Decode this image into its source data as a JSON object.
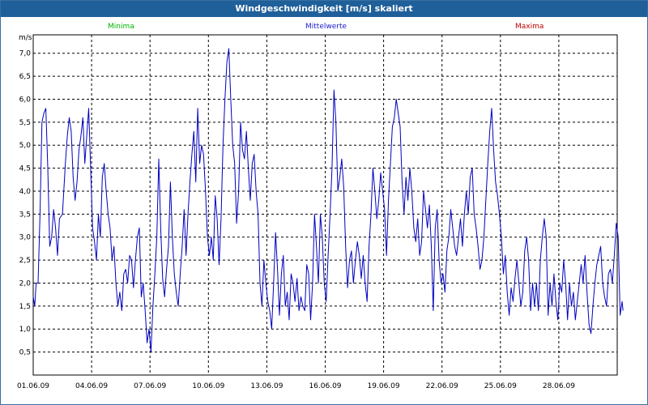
{
  "window": {
    "title": "Windgeschwindigkeit [m/s] skaliert"
  },
  "colors": {
    "series": "#0000c0",
    "minima": "#00b400",
    "mittelwerte": "#1a1ad0",
    "maxima": "#c00000",
    "titlebar": "#1f5f9a"
  },
  "chart_data": {
    "type": "line",
    "title": "Windgeschwindigkeit [m/s] skaliert",
    "ylabel": "m/s",
    "xlabel": "",
    "legend": [
      "Minima",
      "Mittelwerte",
      "Maxima"
    ],
    "legend_placement": "top",
    "grid": true,
    "ylim": [
      0,
      7.4
    ],
    "xlim": [
      "01.06.09",
      "30.06.09 24:00"
    ],
    "y_ticks": [
      "0,5",
      "1,0",
      "1,5",
      "2,0",
      "2,5",
      "3,0",
      "3,5",
      "4,0",
      "4,5",
      "5,0",
      "5,5",
      "6,0",
      "6,5",
      "7,0"
    ],
    "x_ticks": [
      "01.06.09",
      "04.06.09",
      "07.06.09",
      "10.06.09",
      "13.06.09",
      "16.06.09",
      "19.06.09",
      "22.06.09",
      "25.06.09",
      "28.06.09"
    ],
    "series": [
      {
        "name": "Mittelwerte",
        "x_unit": "days from 01.06.09 00:00",
        "points": [
          [
            0.0,
            1.7
          ],
          [
            0.08,
            1.5
          ],
          [
            0.15,
            2.0
          ],
          [
            0.25,
            2.0
          ],
          [
            0.35,
            3.5
          ],
          [
            0.45,
            5.5
          ],
          [
            0.55,
            5.7
          ],
          [
            0.65,
            5.8
          ],
          [
            0.75,
            4.5
          ],
          [
            0.85,
            2.8
          ],
          [
            0.95,
            3.0
          ],
          [
            1.05,
            3.6
          ],
          [
            1.15,
            3.2
          ],
          [
            1.25,
            2.6
          ],
          [
            1.35,
            3.4
          ],
          [
            1.5,
            3.5
          ],
          [
            1.65,
            4.6
          ],
          [
            1.75,
            5.2
          ],
          [
            1.85,
            5.6
          ],
          [
            1.95,
            5.3
          ],
          [
            2.05,
            4.3
          ],
          [
            2.15,
            3.8
          ],
          [
            2.25,
            4.2
          ],
          [
            2.35,
            4.9
          ],
          [
            2.45,
            5.2
          ],
          [
            2.55,
            5.6
          ],
          [
            2.65,
            4.6
          ],
          [
            2.75,
            5.2
          ],
          [
            2.85,
            5.8
          ],
          [
            2.95,
            4.5
          ],
          [
            3.05,
            3.2
          ],
          [
            3.15,
            2.9
          ],
          [
            3.25,
            2.5
          ],
          [
            3.35,
            3.5
          ],
          [
            3.45,
            3.0
          ],
          [
            3.55,
            4.3
          ],
          [
            3.65,
            4.6
          ],
          [
            3.75,
            4.0
          ],
          [
            3.85,
            3.5
          ],
          [
            3.95,
            3.2
          ],
          [
            4.05,
            2.5
          ],
          [
            4.15,
            2.8
          ],
          [
            4.25,
            2.0
          ],
          [
            4.35,
            1.5
          ],
          [
            4.45,
            1.8
          ],
          [
            4.55,
            1.4
          ],
          [
            4.65,
            2.2
          ],
          [
            4.75,
            2.3
          ],
          [
            4.85,
            2.0
          ],
          [
            4.95,
            2.6
          ],
          [
            5.05,
            2.5
          ],
          [
            5.15,
            1.9
          ],
          [
            5.25,
            2.5
          ],
          [
            5.35,
            3.0
          ],
          [
            5.45,
            3.2
          ],
          [
            5.55,
            1.7
          ],
          [
            5.65,
            2.0
          ],
          [
            5.75,
            1.4
          ],
          [
            5.85,
            0.7
          ],
          [
            5.95,
            1.0
          ],
          [
            6.05,
            0.5
          ],
          [
            6.15,
            1.5
          ],
          [
            6.25,
            2.2
          ],
          [
            6.35,
            3.0
          ],
          [
            6.45,
            4.7
          ],
          [
            6.55,
            3.2
          ],
          [
            6.65,
            2.1
          ],
          [
            6.75,
            1.7
          ],
          [
            6.85,
            2.3
          ],
          [
            6.95,
            2.8
          ],
          [
            7.05,
            4.2
          ],
          [
            7.15,
            3.0
          ],
          [
            7.25,
            2.2
          ],
          [
            7.35,
            1.8
          ],
          [
            7.45,
            1.5
          ],
          [
            7.55,
            2.2
          ],
          [
            7.65,
            2.8
          ],
          [
            7.75,
            3.6
          ],
          [
            7.85,
            2.6
          ],
          [
            7.95,
            3.5
          ],
          [
            8.05,
            4.2
          ],
          [
            8.15,
            4.8
          ],
          [
            8.25,
            5.3
          ],
          [
            8.35,
            4.2
          ],
          [
            8.45,
            5.8
          ],
          [
            8.55,
            4.6
          ],
          [
            8.65,
            5.0
          ],
          [
            8.75,
            4.8
          ],
          [
            8.85,
            4.0
          ],
          [
            8.95,
            3.0
          ],
          [
            9.05,
            2.6
          ],
          [
            9.15,
            3.0
          ],
          [
            9.25,
            2.5
          ],
          [
            9.35,
            3.9
          ],
          [
            9.45,
            3.4
          ],
          [
            9.55,
            2.4
          ],
          [
            9.65,
            3.4
          ],
          [
            9.75,
            5.0
          ],
          [
            9.85,
            6.0
          ],
          [
            9.95,
            6.8
          ],
          [
            10.05,
            7.1
          ],
          [
            10.15,
            6.0
          ],
          [
            10.25,
            5.0
          ],
          [
            10.35,
            4.6
          ],
          [
            10.45,
            3.3
          ],
          [
            10.55,
            4.0
          ],
          [
            10.65,
            5.5
          ],
          [
            10.75,
            4.9
          ],
          [
            10.85,
            4.7
          ],
          [
            10.95,
            5.3
          ],
          [
            11.05,
            4.5
          ],
          [
            11.15,
            3.8
          ],
          [
            11.25,
            4.6
          ],
          [
            11.35,
            4.8
          ],
          [
            11.45,
            4.0
          ],
          [
            11.55,
            3.5
          ],
          [
            11.65,
            2.0
          ],
          [
            11.75,
            1.5
          ],
          [
            11.85,
            2.5
          ],
          [
            11.95,
            2.0
          ],
          [
            12.05,
            1.6
          ],
          [
            12.15,
            1.4
          ],
          [
            12.25,
            1.0
          ],
          [
            12.35,
            2.0
          ],
          [
            12.45,
            3.1
          ],
          [
            12.55,
            2.3
          ],
          [
            12.65,
            1.3
          ],
          [
            12.75,
            2.2
          ],
          [
            12.85,
            2.6
          ],
          [
            12.95,
            1.5
          ],
          [
            13.05,
            1.8
          ],
          [
            13.15,
            1.2
          ],
          [
            13.25,
            2.2
          ],
          [
            13.35,
            2.0
          ],
          [
            13.45,
            1.6
          ],
          [
            13.55,
            2.1
          ],
          [
            13.65,
            1.4
          ],
          [
            13.75,
            1.7
          ],
          [
            13.85,
            1.5
          ],
          [
            13.95,
            1.4
          ],
          [
            14.05,
            2.4
          ],
          [
            14.15,
            2.2
          ],
          [
            14.25,
            1.2
          ],
          [
            14.35,
            2.0
          ],
          [
            14.45,
            3.5
          ],
          [
            14.55,
            2.8
          ],
          [
            14.65,
            2.0
          ],
          [
            14.75,
            3.5
          ],
          [
            14.85,
            3.0
          ],
          [
            14.95,
            2.0
          ],
          [
            15.05,
            1.6
          ],
          [
            15.15,
            2.6
          ],
          [
            15.25,
            3.5
          ],
          [
            15.35,
            4.5
          ],
          [
            15.45,
            6.2
          ],
          [
            15.55,
            5.5
          ],
          [
            15.65,
            4.0
          ],
          [
            15.75,
            4.3
          ],
          [
            15.85,
            4.7
          ],
          [
            15.95,
            4.1
          ],
          [
            16.05,
            2.8
          ],
          [
            16.15,
            1.9
          ],
          [
            16.25,
            2.5
          ],
          [
            16.35,
            2.7
          ],
          [
            16.45,
            2.0
          ],
          [
            16.55,
            2.5
          ],
          [
            16.65,
            2.9
          ],
          [
            16.75,
            2.6
          ],
          [
            16.85,
            2.1
          ],
          [
            16.95,
            2.6
          ],
          [
            17.05,
            2.0
          ],
          [
            17.15,
            1.6
          ],
          [
            17.25,
            2.8
          ],
          [
            17.35,
            3.5
          ],
          [
            17.45,
            4.5
          ],
          [
            17.55,
            4.0
          ],
          [
            17.65,
            3.4
          ],
          [
            17.75,
            3.8
          ],
          [
            17.85,
            4.4
          ],
          [
            17.95,
            4.0
          ],
          [
            18.05,
            3.6
          ],
          [
            18.15,
            2.6
          ],
          [
            18.25,
            3.8
          ],
          [
            18.35,
            4.6
          ],
          [
            18.45,
            5.4
          ],
          [
            18.55,
            5.6
          ],
          [
            18.65,
            6.0
          ],
          [
            18.75,
            5.7
          ],
          [
            18.85,
            5.4
          ],
          [
            18.95,
            4.2
          ],
          [
            19.05,
            3.5
          ],
          [
            19.15,
            4.3
          ],
          [
            19.25,
            3.8
          ],
          [
            19.35,
            4.5
          ],
          [
            19.45,
            4.0
          ],
          [
            19.55,
            3.2
          ],
          [
            19.65,
            2.9
          ],
          [
            19.75,
            3.4
          ],
          [
            19.85,
            2.6
          ],
          [
            19.95,
            2.9
          ],
          [
            20.05,
            4.0
          ],
          [
            20.15,
            3.6
          ],
          [
            20.25,
            3.2
          ],
          [
            20.35,
            3.7
          ],
          [
            20.45,
            2.8
          ],
          [
            20.55,
            1.4
          ],
          [
            20.65,
            3.2
          ],
          [
            20.75,
            3.6
          ],
          [
            20.85,
            2.5
          ],
          [
            20.95,
            2.0
          ],
          [
            21.05,
            2.2
          ],
          [
            21.15,
            1.8
          ],
          [
            21.25,
            2.7
          ],
          [
            21.35,
            3.0
          ],
          [
            21.45,
            3.6
          ],
          [
            21.55,
            3.2
          ],
          [
            21.65,
            2.8
          ],
          [
            21.75,
            2.6
          ],
          [
            21.85,
            3.0
          ],
          [
            21.95,
            3.4
          ],
          [
            22.05,
            2.8
          ],
          [
            22.15,
            3.5
          ],
          [
            22.25,
            4.0
          ],
          [
            22.35,
            3.5
          ],
          [
            22.45,
            4.3
          ],
          [
            22.55,
            4.5
          ],
          [
            22.65,
            3.5
          ],
          [
            22.75,
            3.2
          ],
          [
            22.85,
            2.8
          ],
          [
            22.95,
            2.3
          ],
          [
            23.05,
            2.5
          ],
          [
            23.15,
            3.0
          ],
          [
            23.25,
            3.8
          ],
          [
            23.35,
            4.6
          ],
          [
            23.45,
            5.3
          ],
          [
            23.55,
            5.8
          ],
          [
            23.65,
            4.9
          ],
          [
            23.75,
            4.2
          ],
          [
            23.85,
            3.9
          ],
          [
            23.95,
            3.5
          ],
          [
            24.05,
            3.0
          ],
          [
            24.15,
            2.2
          ],
          [
            24.25,
            2.6
          ],
          [
            24.35,
            1.8
          ],
          [
            24.45,
            1.3
          ],
          [
            24.55,
            1.9
          ],
          [
            24.65,
            1.6
          ],
          [
            24.75,
            2.1
          ],
          [
            24.85,
            2.5
          ],
          [
            24.95,
            2.0
          ],
          [
            25.05,
            1.5
          ],
          [
            25.15,
            1.8
          ],
          [
            25.25,
            2.7
          ],
          [
            25.35,
            3.0
          ],
          [
            25.45,
            2.5
          ],
          [
            25.55,
            1.4
          ],
          [
            25.65,
            2.0
          ],
          [
            25.75,
            1.5
          ],
          [
            25.85,
            2.0
          ],
          [
            25.95,
            1.4
          ],
          [
            26.05,
            2.5
          ],
          [
            26.15,
            3.0
          ],
          [
            26.25,
            3.4
          ],
          [
            26.35,
            3.0
          ],
          [
            26.45,
            1.3
          ],
          [
            26.55,
            2.0
          ],
          [
            26.65,
            1.5
          ],
          [
            26.75,
            2.2
          ],
          [
            26.85,
            1.6
          ],
          [
            26.95,
            1.2
          ],
          [
            27.05,
            2.0
          ],
          [
            27.15,
            1.8
          ],
          [
            27.25,
            2.5
          ],
          [
            27.35,
            2.0
          ],
          [
            27.45,
            1.2
          ],
          [
            27.55,
            2.0
          ],
          [
            27.65,
            1.5
          ],
          [
            27.75,
            1.8
          ],
          [
            27.85,
            1.2
          ],
          [
            27.95,
            1.6
          ],
          [
            28.05,
            2.0
          ],
          [
            28.15,
            2.4
          ],
          [
            28.25,
            2.0
          ],
          [
            28.35,
            2.6
          ],
          [
            28.45,
            1.8
          ],
          [
            28.55,
            1.1
          ],
          [
            28.65,
            0.9
          ],
          [
            28.75,
            1.5
          ],
          [
            28.85,
            2.0
          ],
          [
            28.95,
            2.4
          ],
          [
            29.05,
            2.6
          ],
          [
            29.15,
            2.8
          ],
          [
            29.25,
            2.0
          ],
          [
            29.35,
            1.7
          ],
          [
            29.45,
            1.5
          ],
          [
            29.55,
            2.2
          ],
          [
            29.65,
            2.3
          ],
          [
            29.75,
            2.0
          ],
          [
            29.85,
            2.6
          ],
          [
            29.95,
            3.3
          ],
          [
            30.05,
            3.0
          ],
          [
            30.15,
            1.3
          ],
          [
            30.25,
            1.6
          ],
          [
            30.3,
            1.4
          ]
        ]
      }
    ]
  }
}
